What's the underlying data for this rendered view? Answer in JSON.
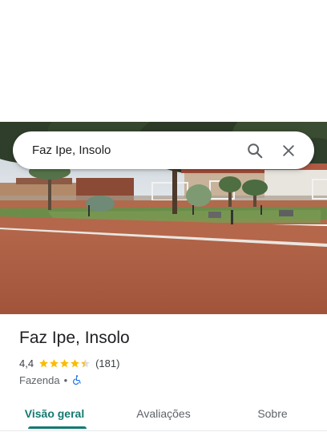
{
  "search": {
    "query": "Faz Ipe, Insolo",
    "search_icon": "search-icon",
    "close_icon": "close-icon"
  },
  "place": {
    "name": "Faz Ipe, Insolo",
    "rating": "4,4",
    "rating_value": 4.4,
    "rating_max": 5,
    "reviews": "(181)",
    "category": "Fazenda",
    "separator": "•",
    "accessibility_icon": "wheelchair-icon",
    "star_color": "#fbbc04"
  },
  "tabs": [
    {
      "label": "Visão geral",
      "active": true
    },
    {
      "label": "Avaliações",
      "active": false
    },
    {
      "label": "Sobre",
      "active": false
    }
  ],
  "colors": {
    "accent": "#137a70",
    "accessibility": "#1a73e8"
  }
}
